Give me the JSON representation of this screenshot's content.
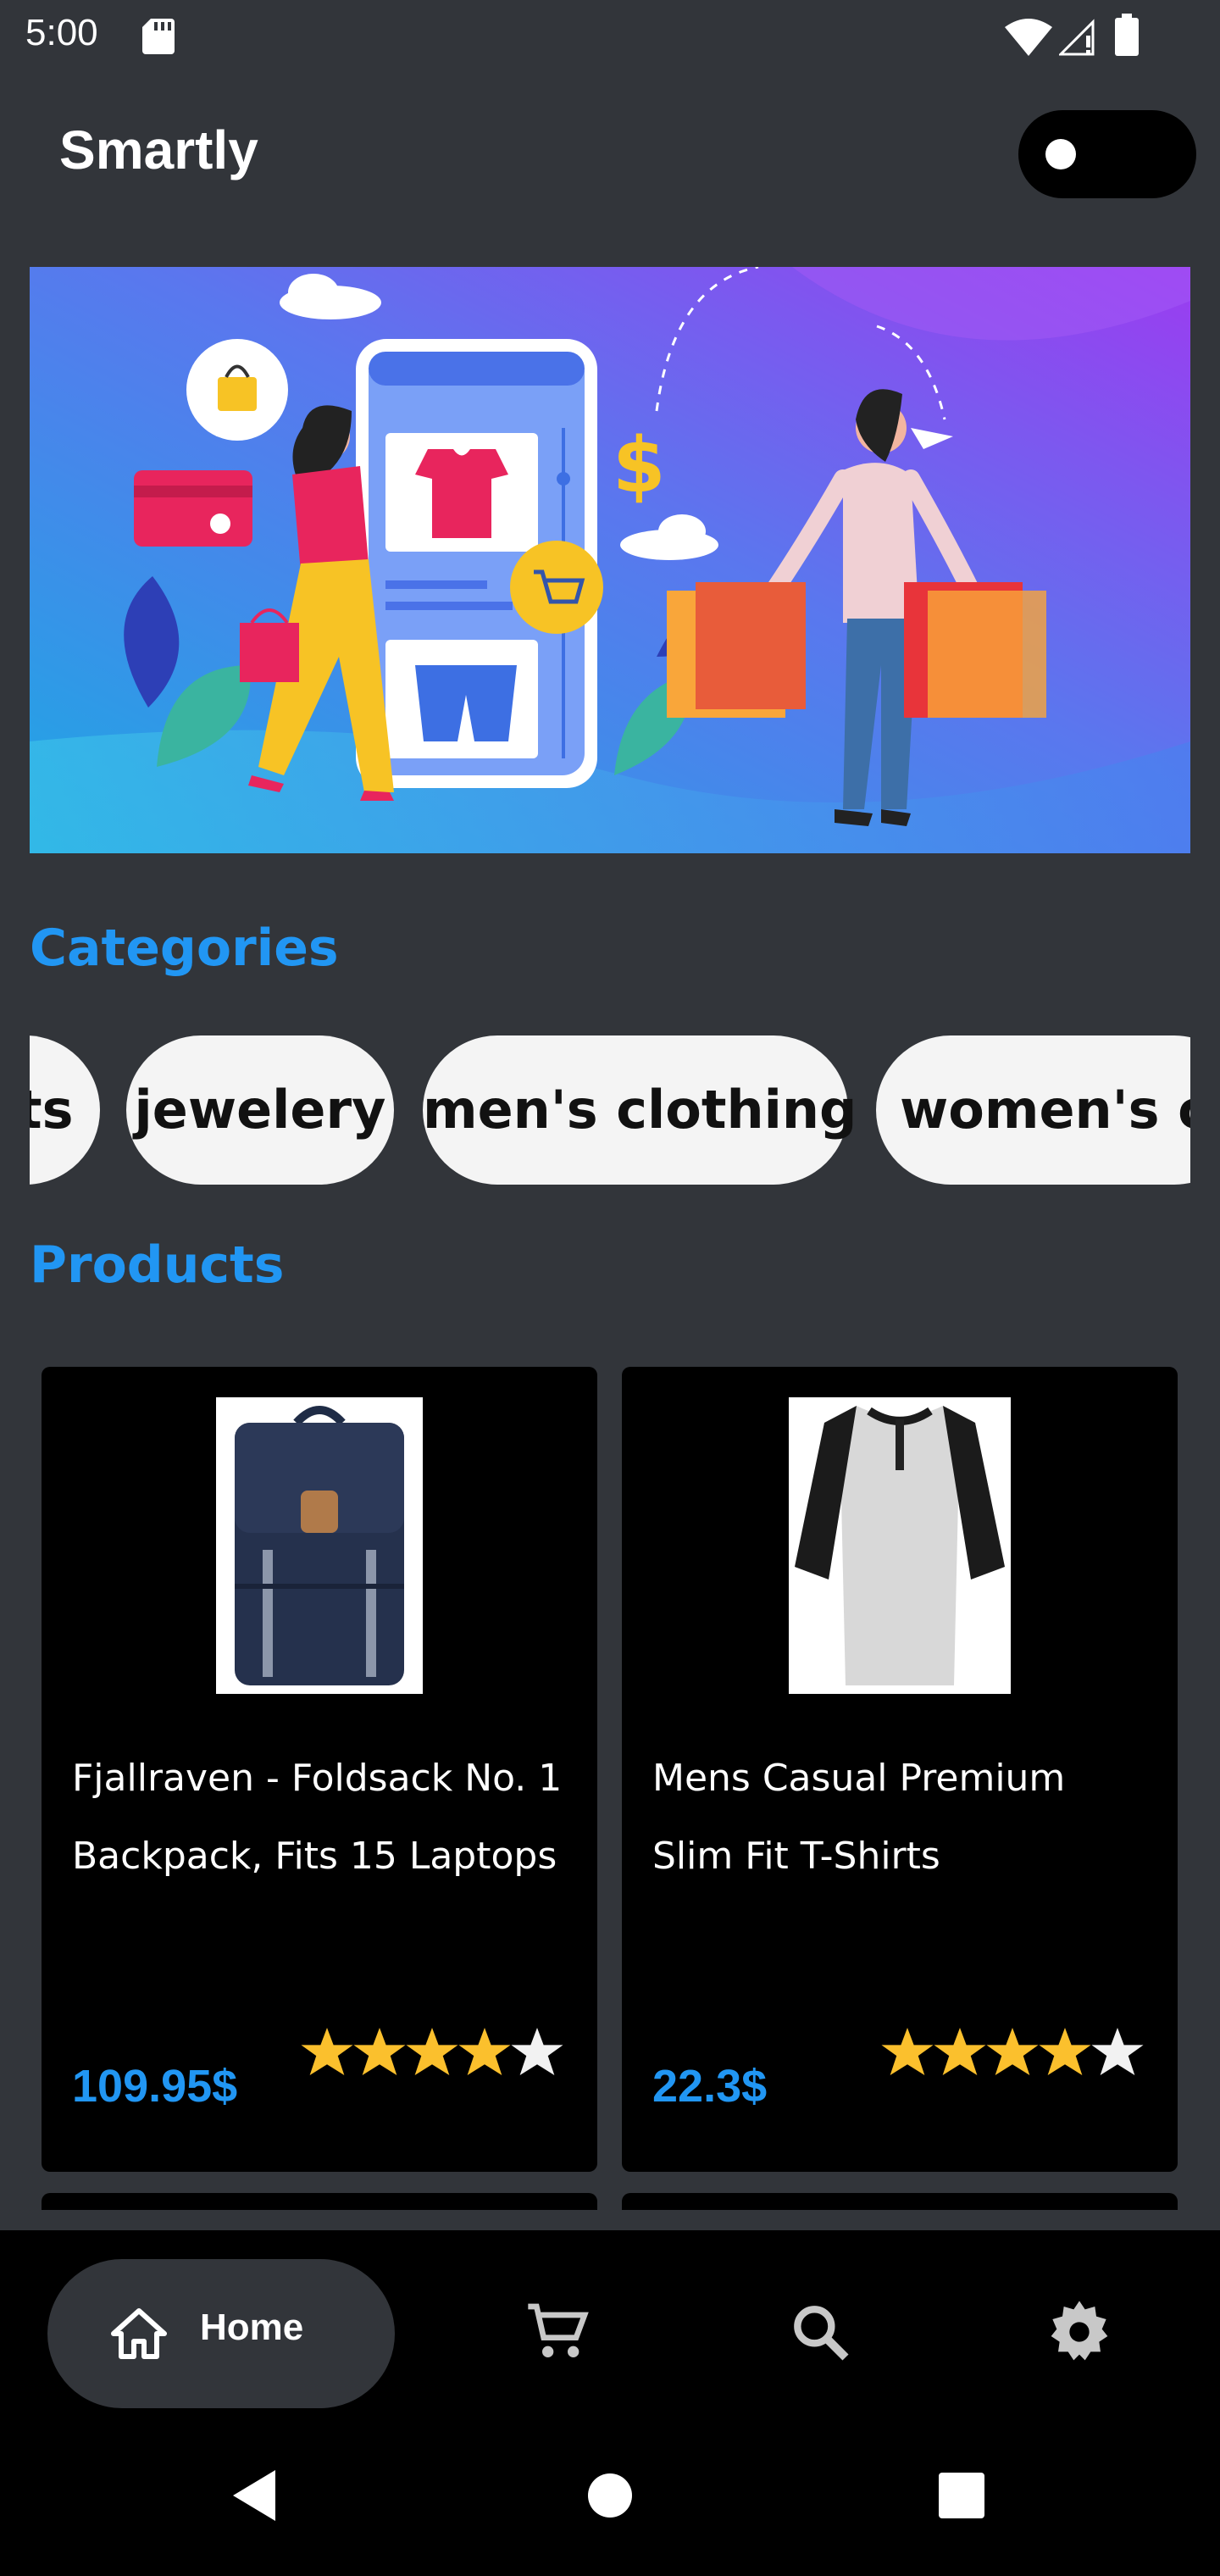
{
  "status": {
    "time": "5:00"
  },
  "header": {
    "title": "Smartly"
  },
  "sections": {
    "categories_title": "Categories",
    "products_title": "Products"
  },
  "categories": [
    "ts",
    "jewelery",
    "men's clothing",
    "women's cl"
  ],
  "products": [
    {
      "title": "Fjallraven - Foldsack No. 1 Backpack, Fits 15 Laptops",
      "price": "109.95$",
      "rating": 4
    },
    {
      "title": "Mens Casual Premium Slim Fit T-Shirts",
      "price": "22.3$",
      "rating": 4
    }
  ],
  "bottom_nav": {
    "home_label": "Home",
    "icons": [
      "home-icon",
      "cart-icon",
      "search-icon",
      "settings-icon"
    ]
  },
  "colors": {
    "accent": "#2196f3",
    "background": "#32353a",
    "card": "#000000",
    "star": "#fbc02d",
    "banner_start": "#1ea7e4",
    "banner_end": "#9b3cf0"
  }
}
